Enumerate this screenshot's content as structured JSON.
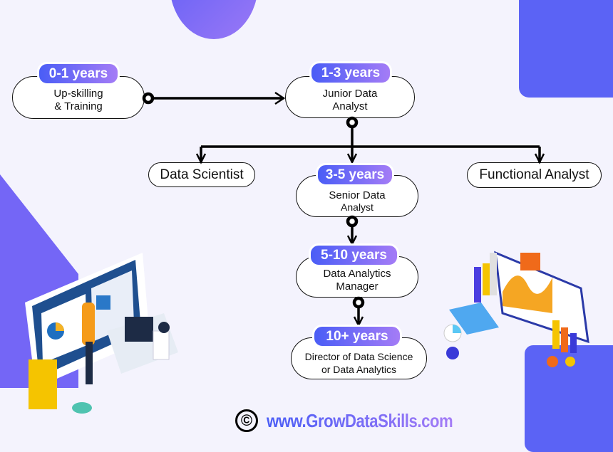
{
  "stages": [
    {
      "years": "0-1 years",
      "role_line1": "Up-skilling",
      "role_line2": "& Training"
    },
    {
      "years": "1-3 years",
      "role_line1": "Junior Data",
      "role_line2": "Analyst"
    },
    {
      "years": "3-5 years",
      "role_line1": "Senior Data",
      "role_line2": "Analyst"
    },
    {
      "years": "5-10 years",
      "role_line1": "Data Analytics",
      "role_line2": "Manager"
    },
    {
      "years": "10+ years",
      "role_line1": "Director of Data Science",
      "role_line2": "or Data Analytics"
    }
  ],
  "branches": {
    "left": "Data Scientist",
    "right": "Functional Analyst"
  },
  "footer": {
    "copyright_icon": "©",
    "url": "www.GrowDataSkills.com"
  },
  "colors": {
    "gradient_start": "#4a5df6",
    "gradient_end": "#a47cf6",
    "background": "#f4f3fd",
    "accent": "#5b63f5"
  }
}
